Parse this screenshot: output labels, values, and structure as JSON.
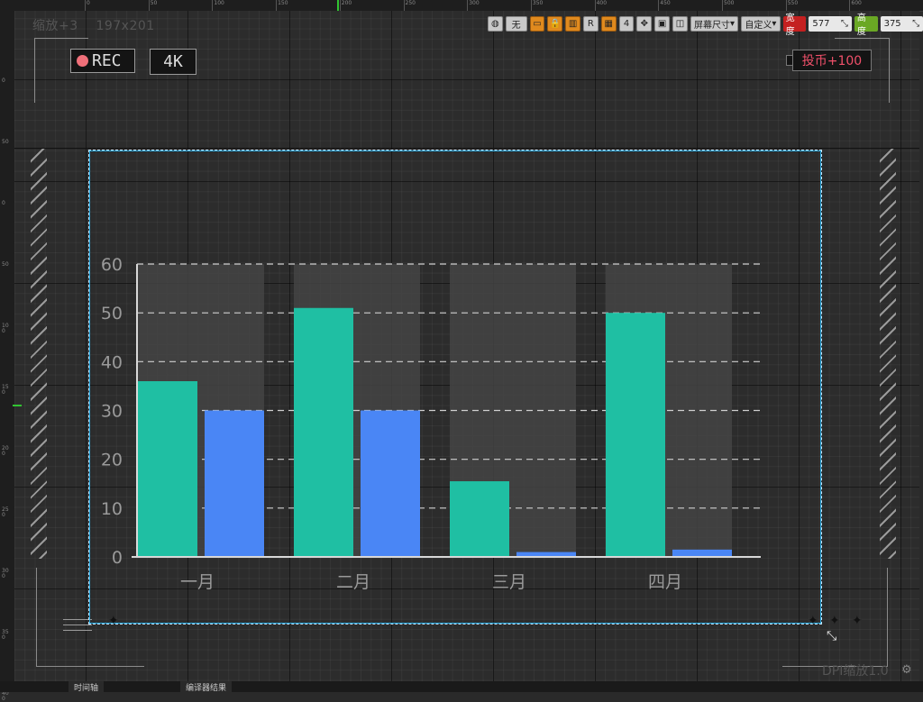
{
  "zoom_label": "缩放+3",
  "widget_size": "197x201",
  "ruler_top": [
    "0",
    "50",
    "100",
    "150",
    "200",
    "250",
    "300",
    "350",
    "400",
    "450",
    "500",
    "550",
    "600"
  ],
  "ruler_left": [
    "0",
    "50",
    "0",
    "50",
    "100",
    "150",
    "200",
    "250",
    "300",
    "350",
    "400"
  ],
  "toolbar": {
    "none_label": "无",
    "r_label": "R",
    "grid_value": "4",
    "screen_size_label": "屏幕尺寸",
    "custom_label": "自定义",
    "width_label": "宽度",
    "width_value": "577",
    "height_label": "高度",
    "height_value": "375"
  },
  "overlay": {
    "rec_label": "REC",
    "resolution_label": "4K",
    "coin_label": "投币+100"
  },
  "dpi_label": "DPI缩放1.0",
  "bottom_tabs": [
    "时间轴",
    "编译器结果"
  ],
  "colors": {
    "series1": "#1fbfa3",
    "series2": "#4a86f5",
    "selection": "#29a8e0",
    "coin_text": "#f0506a",
    "rec_dot": "#f0707a"
  },
  "chart_data": {
    "type": "bar",
    "categories": [
      "一月",
      "二月",
      "三月",
      "四月"
    ],
    "series": [
      {
        "values": [
          36,
          51,
          15.5,
          50
        ]
      },
      {
        "values": [
          30,
          30,
          1,
          1.5
        ]
      }
    ],
    "ylim": [
      0,
      60
    ],
    "yticks": [
      "0",
      "10",
      "20",
      "30",
      "40",
      "50",
      "60"
    ],
    "grid": true
  }
}
